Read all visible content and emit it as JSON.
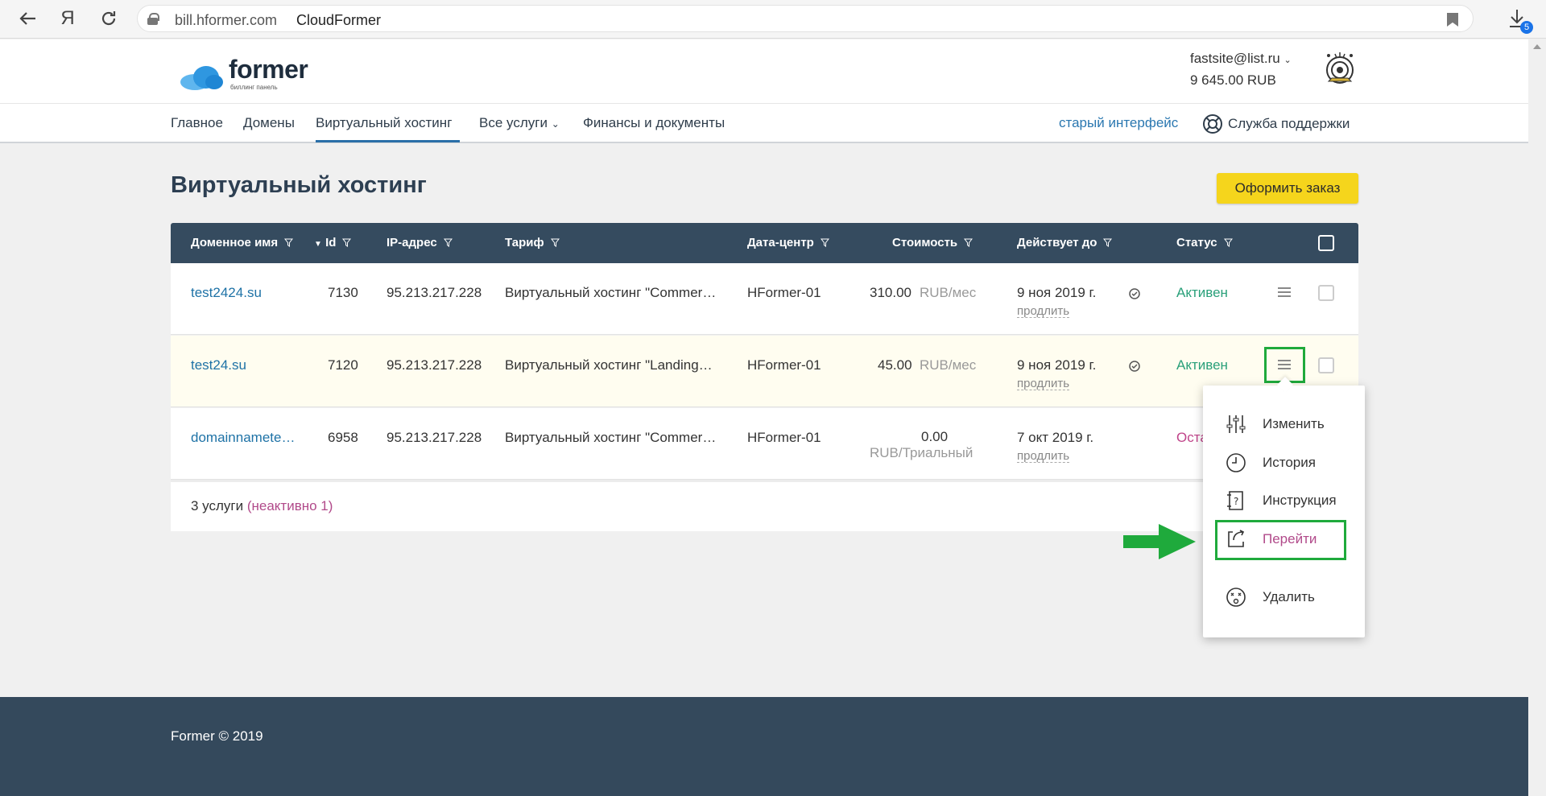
{
  "browser": {
    "url": "bill.hformer.com",
    "page_title": "CloudFormer",
    "yandex_label": "Я",
    "downloads_badge": "5"
  },
  "header": {
    "logo_text": "former",
    "logo_tagline": "биллинг панель",
    "account_email": "fastsite@list.ru",
    "account_balance": "9 645.00 RUB"
  },
  "nav": {
    "items": [
      "Главное",
      "Домены",
      "Виртуальный хостинг",
      "Все услуги",
      "Финансы и документы"
    ],
    "active": "Виртуальный хостинг",
    "old_interface": "старый интерфейс",
    "support": "Служба поддержки"
  },
  "main": {
    "title": "Виртуальный хостинг",
    "order_button": "Оформить заказ"
  },
  "table": {
    "columns": [
      "Доменное имя",
      "Id",
      "IP-адрес",
      "Тариф",
      "Дата-центр",
      "Стоимость",
      "Действует до",
      "Статус"
    ],
    "rows": [
      {
        "domain": "test2424.su",
        "id": "7130",
        "ip": "95.213.217.228",
        "tariff": "Виртуальный хостинг \"Commer…",
        "dc": "HFormer-01",
        "price": "310.00",
        "unit": "RUB/мес",
        "until": "9 ноя 2019 г.",
        "renew": "продлить",
        "status": "Активен"
      },
      {
        "domain": "test24.su",
        "id": "7120",
        "ip": "95.213.217.228",
        "tariff": "Виртуальный хостинг \"Landing…",
        "dc": "HFormer-01",
        "price": "45.00",
        "unit": "RUB/мес",
        "until": "9 ноя 2019 г.",
        "renew": "продлить",
        "status": "Активен"
      },
      {
        "domain": "domainnamete…",
        "id": "6958",
        "ip": "95.213.217.228",
        "tariff": "Виртуальный хостинг \"Commer…",
        "dc": "HFormer-01",
        "price": "0.00",
        "unit": "RUB/Триальный",
        "until": "7 окт 2019 г.",
        "renew": "продлить",
        "status": "Оста"
      }
    ],
    "footer_count": "3 услуги",
    "footer_inactive": "(неактивно 1)"
  },
  "dropdown": {
    "items": [
      "Изменить",
      "История",
      "Инструкция",
      "Перейти",
      "Удалить"
    ]
  },
  "footer": {
    "copyright": "Former © 2019"
  },
  "colors": {
    "header_dark": "#354b5f",
    "accent_yellow": "#f5d51c",
    "status_green": "#2aa07a",
    "highlight_green": "#1faa3c",
    "accent_pink": "#b14a8a",
    "link_blue": "#1e72a6"
  }
}
